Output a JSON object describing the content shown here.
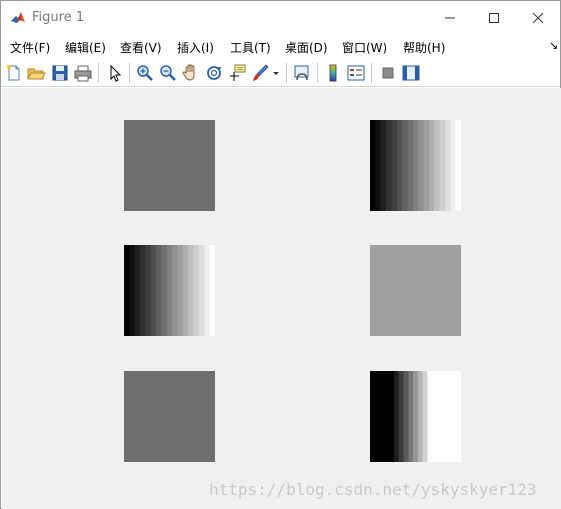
{
  "window": {
    "title": "Figure 1"
  },
  "menu": {
    "items": [
      "文件(F)",
      "编辑(E)",
      "查看(V)",
      "插入(I)",
      "工具(T)",
      "桌面(D)",
      "窗口(W)",
      "帮助(H)"
    ],
    "overflow": "↘"
  },
  "toolbar": {
    "icons": [
      "new-figure-icon",
      "open-file-icon",
      "save-icon",
      "print-icon",
      "edit-plot-icon",
      "zoom-in-icon",
      "zoom-out-icon",
      "pan-icon",
      "rotate-3d-icon",
      "data-cursor-icon",
      "brush-icon",
      "link-plot-icon",
      "colorbar-icon",
      "legend-icon",
      "hide-plot-tools-icon",
      "show-plot-tools-icon"
    ]
  },
  "figure": {
    "images": [
      {
        "name": "uniform-gray-top-left",
        "type": "uniform",
        "gray": 110
      },
      {
        "name": "gradient-top-right",
        "type": "gradient",
        "steps": 17,
        "from": 0,
        "to": 255
      },
      {
        "name": "gradient-middle-left",
        "type": "gradient",
        "steps": 17,
        "from": 0,
        "to": 255
      },
      {
        "name": "uniform-gray-middle-right",
        "type": "uniform",
        "gray": 160
      },
      {
        "name": "uniform-gray-bottom-left",
        "type": "uniform",
        "gray": 110
      },
      {
        "name": "quantized-gradient-bottom-right",
        "type": "quantized",
        "colors": [
          "#000000",
          "#000000",
          "#000000",
          "#000000",
          "#000000",
          "#1e1e1e",
          "#3c3c3c",
          "#5a5a5a",
          "#787878",
          "#969696",
          "#b4b4b4",
          "#d2d2d2",
          "#ffffff",
          "#ffffff",
          "#ffffff",
          "#ffffff",
          "#ffffff",
          "#ffffff",
          "#ffffff"
        ]
      }
    ]
  },
  "watermark": "https://blog.csdn.net/yskyskyer123"
}
